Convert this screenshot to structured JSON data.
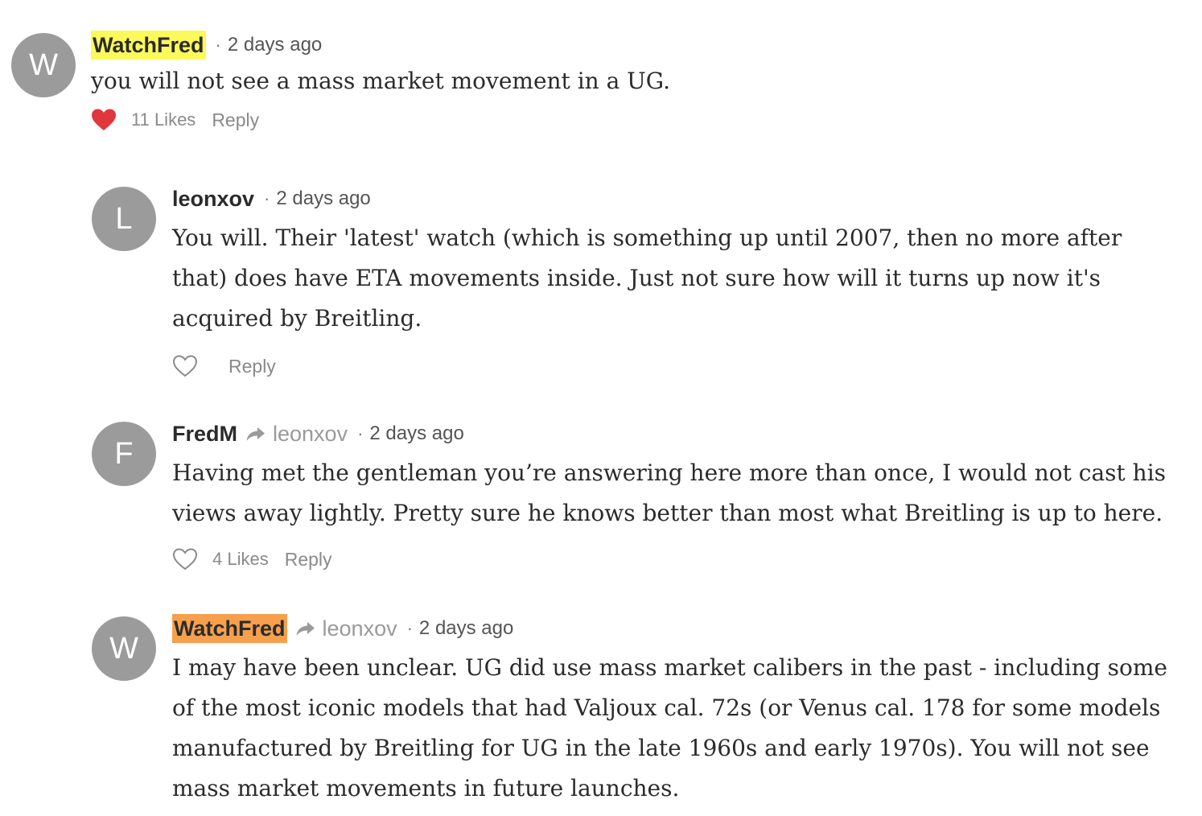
{
  "comments": [
    {
      "avatar_letter": "W",
      "author": "WatchFred",
      "reply_to": "",
      "separator": "·",
      "time": "2 days ago",
      "text": "you will not see a mass market movement in a UG.",
      "likes": "11 Likes",
      "liked": true,
      "reply_label": "Reply"
    },
    {
      "avatar_letter": "L",
      "author": "leonxov",
      "reply_to": "",
      "separator": "·",
      "time": "2 days ago",
      "text": "You will. Their 'latest' watch (which is something up until 2007, then no more after that) does have ETA movements inside. Just not sure how will it turns up now it's acquired by Breitling.",
      "likes": "",
      "liked": false,
      "reply_label": "Reply"
    },
    {
      "avatar_letter": "F",
      "author": "FredM",
      "reply_to": "leonxov",
      "separator": "·",
      "time": "2 days ago",
      "text": "Having met the gentleman you’re answering here more than once, I would not cast his views away lightly. Pretty sure he knows better than most what Breitling is up to here.",
      "likes": "4 Likes",
      "liked": false,
      "reply_label": "Reply"
    },
    {
      "avatar_letter": "W",
      "author": "WatchFred",
      "reply_to": "leonxov",
      "separator": "·",
      "time": "2 days ago",
      "text": "I may have been unclear. UG did use mass market calibers in the past - including some of the most iconic models that had Valjoux cal. 72s (or Venus cal. 178 for some models manufactured by Breitling for UG in the late 1960s and early 1970s). You will not see mass market movements in future launches.",
      "likes": "",
      "liked": false,
      "reply_label": ""
    }
  ],
  "colors": {
    "avatar_bg": "#9b9b9b",
    "highlight_yellow": "#fbf95b",
    "highlight_orange": "#f6a04d",
    "heart_red": "#e0363d",
    "muted_text": "#8a8a8a"
  },
  "icons": {
    "liked": "heart-filled-icon",
    "unliked": "heart-outline-icon",
    "reply_to": "reply-arrow-icon"
  }
}
